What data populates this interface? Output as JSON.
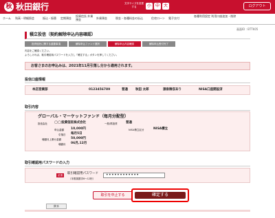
{
  "header": {
    "bank_name": "秋田銀行",
    "logo_mark": "秋",
    "font_size_label": "文字サイズを変更する",
    "font_sizes": [
      "小",
      "中",
      "大"
    ],
    "logout": "ログアウト"
  },
  "nav": {
    "items": [
      "ホーム",
      "残高・明細照会",
      "振込・振替",
      "定期預金",
      "投資信託 外貨預金",
      "外貨預金",
      "税金・各種料金の払込",
      "住宅ローン",
      "電子交付",
      "各種利用設定 利用口座追加・削除"
    ]
  },
  "screen_id": "画面ID : BTTK05",
  "page_title": "積立投信（契約解除申込内容確認）",
  "steps": [
    "投資信託に関する重要事項",
    "解除申込ファンド選択",
    "解除申込内容確認",
    "解除申込受付完了"
  ],
  "intro": [
    "内容をご確認ください。",
    "よろしければ、取引確認用パスワードを入力し「確定する」ボタンを押してください。"
  ],
  "notice": "お客さまのお申込みは、2021年11月引落し分から適用されます。",
  "account": {
    "section": "投信口座情報",
    "branch": "本店営業部",
    "number": "0123456789",
    "type": "普通",
    "name": "秋田 太郎",
    "status": "源泉徴収あり",
    "nisa": "NISA口座開設済"
  },
  "trade": {
    "section": "取引内容",
    "fund_name": "グローバル・マーケットファンド（毎月分配型）",
    "mgmt_label": "投信会社",
    "mgmt_value": "◯◯投資信託株式会社",
    "category": "一般/再投資",
    "risk": "普通",
    "start_label": "申込金額",
    "start_value": "10,000円",
    "day_label": "引落日",
    "day_value": "毎月5日",
    "bonus_label": "増額月上乗せ金額",
    "bonus_value": "50,000円",
    "bonus_month_label": "増額月",
    "bonus_month_value": "06月,12月",
    "nisa_label": "NISA積立区分",
    "nisa_value": "NISA積立"
  },
  "password": {
    "section": "取引確認用パスワードの入力",
    "required": "必須",
    "label": "取引確認用パスワード",
    "hint": "（半角英数字6〜12桁）",
    "value": "••••••••••••"
  },
  "buttons": {
    "cancel": "取引を中止する",
    "confirm": "確定する",
    "back": "戻る"
  }
}
